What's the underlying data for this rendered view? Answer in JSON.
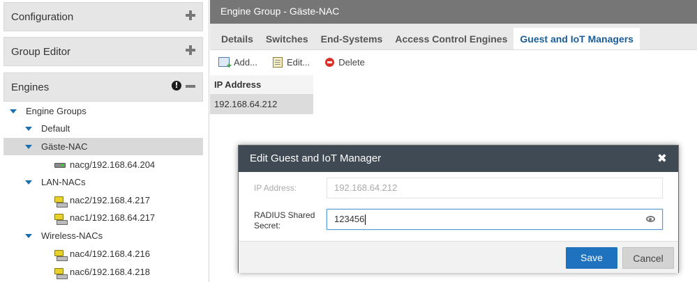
{
  "sidebar": {
    "panels": [
      {
        "label": "Configuration",
        "control": "plus"
      },
      {
        "label": "Group Editor",
        "control": "plus"
      },
      {
        "label": "Engines",
        "control": "minus"
      }
    ],
    "tree": [
      {
        "label": "Engine Groups",
        "type": "group"
      },
      {
        "label": "Default",
        "type": "group"
      },
      {
        "label": "Gäste-NAC",
        "type": "group",
        "selected": true
      },
      {
        "label": "nacg/192.168.64.204",
        "type": "engine",
        "icon": "server-grey-icon"
      },
      {
        "label": "LAN-NACs",
        "type": "group"
      },
      {
        "label": "nac2/192.168.4.217",
        "type": "engine",
        "icon": "server-yellow-icon"
      },
      {
        "label": "nac1/192.168.64.217",
        "type": "engine",
        "icon": "server-yellow-icon"
      },
      {
        "label": "Wireless-NACs",
        "type": "group"
      },
      {
        "label": "nac4/192.168.4.216",
        "type": "engine",
        "icon": "server-yellow-icon"
      },
      {
        "label": "nac6/192.168.4.218",
        "type": "engine",
        "icon": "server-yellow-icon"
      }
    ]
  },
  "main": {
    "title": "Engine Group - Gäste-NAC",
    "tabs": [
      {
        "label": "Details"
      },
      {
        "label": "Switches"
      },
      {
        "label": "End-Systems"
      },
      {
        "label": "Access Control Engines"
      },
      {
        "label": "Guest and IoT Managers",
        "active": true
      }
    ],
    "toolbar": {
      "add": "Add...",
      "edit": "Edit...",
      "delete": "Delete"
    },
    "grid": {
      "column": "IP Address",
      "rows": [
        "192.168.64.212"
      ]
    }
  },
  "dialog": {
    "title": "Edit Guest and IoT Manager",
    "close_glyph": "✖",
    "ip_label": "IP Address:",
    "ip_value": "192.168.64.212",
    "secret_label": "RADIUS Shared Secret:",
    "secret_value": "123456",
    "save": "Save",
    "cancel": "Cancel"
  },
  "colors": {
    "accent": "#1f73be",
    "title_bar": "#767676",
    "dialog_header": "#3f4a54",
    "active_tab_text": "#1a5d96",
    "tree_caret": "#1a6fb0"
  }
}
